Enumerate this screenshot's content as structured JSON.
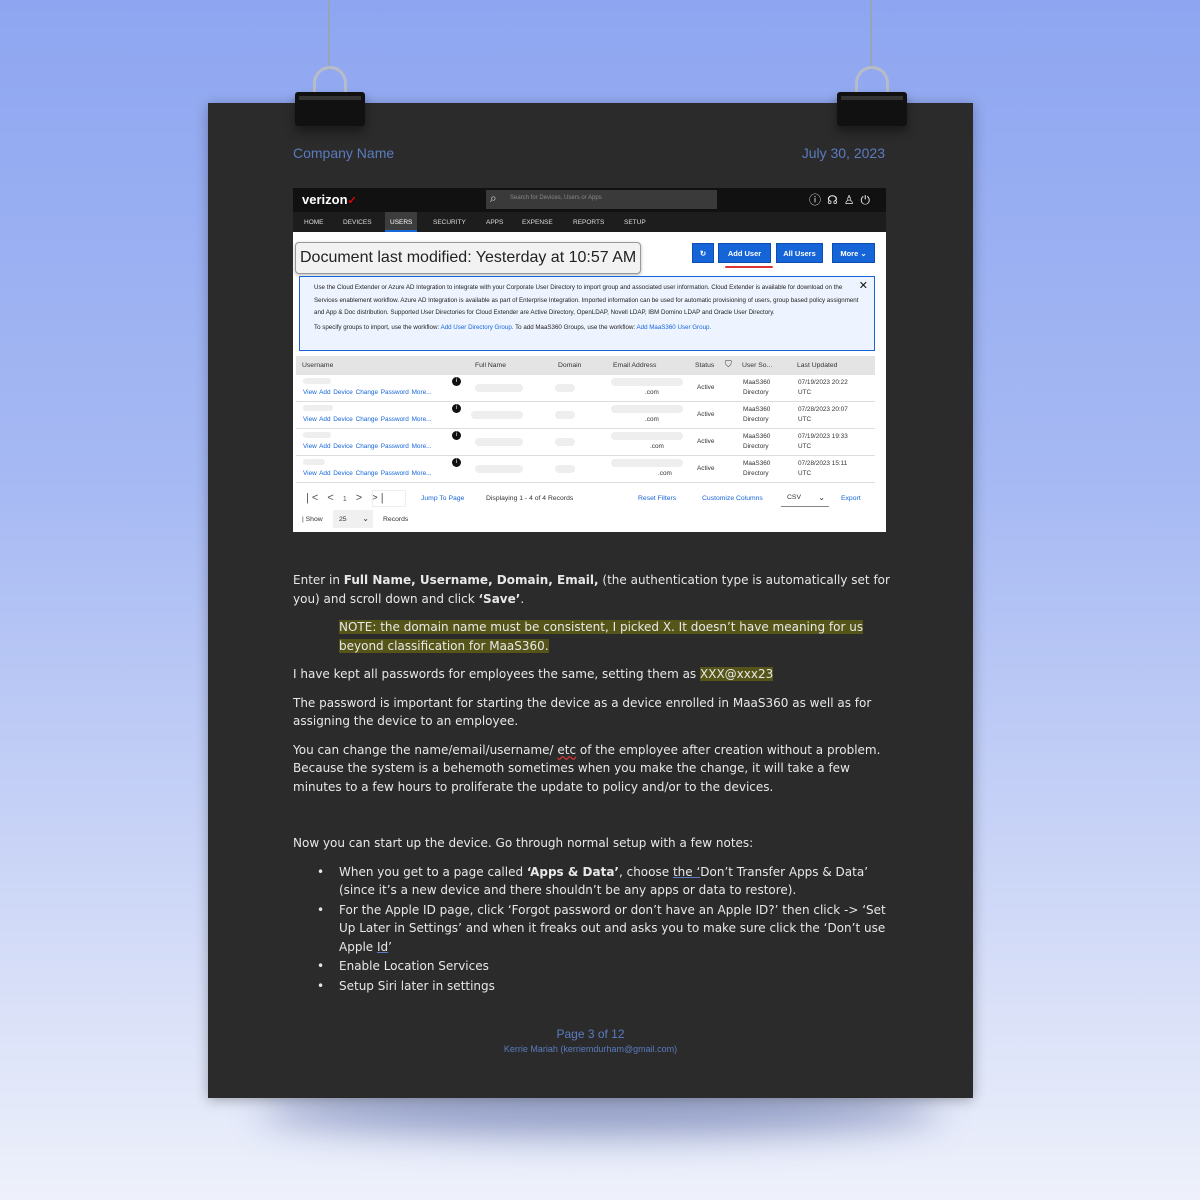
{
  "header": {
    "company": "Company Name",
    "date": "July 30, 2023"
  },
  "screenshot": {
    "brand": "verizon",
    "search_placeholder": "Search for Devices, Users or Apps",
    "nav": [
      "HOME",
      "DEVICES",
      "USERS",
      "SECURITY",
      "APPS",
      "EXPENSE",
      "REPORTS",
      "SETUP"
    ],
    "active_nav": "USERS",
    "doc_modified": "Document last modified: Yesterday at 10:57 AM",
    "buttons": {
      "refresh": "↻",
      "add_user": "Add User",
      "all_users": "All Users",
      "more": "More"
    },
    "info": {
      "line1": "Use the Cloud Extender or Azure AD Integration to integrate with your Corporate User Directory to import group and associated user information. Cloud Extender is available for download on the Services enablement workflow. Azure AD Integration is available as part of Enterprise Integration. Imported information can be used for automatic provisioning of users, group based policy assignment and App & Doc distribution. Supported User Directories for Cloud Extender are Active Directory, OpenLDAP, Novell LDAP, IBM Domino LDAP and Oracle User Directory.",
      "line2_pre": "To specify groups to import, use the workflow:",
      "link1": "Add User Directory Group.",
      "line2_mid": "To add MaaS360 Groups, use the workflow:",
      "link2": "Add MaaS360 User Group."
    },
    "columns": [
      "Username",
      "Full Name",
      "Domain",
      "Email Address",
      "Status",
      "User So...",
      "Last Updated"
    ],
    "row_links": "View  Add Device   Change Password   More...",
    "rows": [
      {
        "email_tail": ".com",
        "status": "Active",
        "source1": "MaaS360",
        "source2": "Directory",
        "updated1": "07/19/2023 20:22",
        "updated2": "UTC"
      },
      {
        "email_tail": ".com",
        "status": "Active",
        "source1": "MaaS360",
        "source2": "Directory",
        "updated1": "07/28/2023 20:07",
        "updated2": "UTC"
      },
      {
        "email_tail": ".com",
        "status": "Active",
        "source1": "MaaS360",
        "source2": "Directory",
        "updated1": "07/19/2023 19:33",
        "updated2": "UTC"
      },
      {
        "email_tail": ".com",
        "status": "Active",
        "source1": "MaaS360",
        "source2": "Directory",
        "updated1": "07/28/2023 15:11",
        "updated2": "UTC"
      }
    ],
    "pager": {
      "page": "1",
      "jump": "Jump To Page",
      "displaying": "Displaying 1 - 4 of 4 Records",
      "reset": "Reset Filters",
      "customize": "Customize Columns",
      "format": "CSV",
      "export": "Export",
      "show": "| Show",
      "per_page": "25",
      "records": "Records"
    }
  },
  "body": {
    "p1_a": "Enter in ",
    "p1_b": "Full Name, Username, Domain, Email,",
    "p1_c": " (the authentication type is automatically set for you) and scroll down and click ",
    "p1_d": "‘Save’",
    "p1_e": ".",
    "note": "NOTE: the domain name must be consistent, I picked X. It doesn’t have meaning for us beyond classification for MaaS360.",
    "p2_a": "I have kept all passwords for employees the same, setting them as ",
    "p2_pw": "XXX@xxx23",
    "p3": "The password is important for starting the device as a device enrolled in MaaS360 as well as for assigning the device to an employee.",
    "p4_a": "You can change the name/email/username/ ",
    "p4_etc": "etc",
    "p4_b": " of the employee after creation without a problem. Because the system is a behemoth sometimes when you make the change, it will take a few minutes to a few hours to proliferate the update to policy and/or to the devices.",
    "p5": "Now you can start up the device. Go through normal setup with a few notes:",
    "b1_a": "When you get to a page called ",
    "b1_b": "‘Apps & Data’",
    "b1_c": ", choose ",
    "b1_the": "the ‘",
    "b1_d": "Don’t Transfer Apps & Data’ (since it’s a new device and there shouldn’t be any apps or data to restore).",
    "b2_a": "For the Apple ID page, click ‘Forgot password or don’t have an Apple ID?’ then click -> ‘Set Up Later in Settings’ and when it freaks out and asks you to make sure click the ‘Don’t use Apple ",
    "b2_id": "Id",
    "b2_b": "’",
    "b3": "Enable Location Services",
    "b4": "Setup Siri later in settings"
  },
  "footer": {
    "page": "Page 3 of 12",
    "author": "Kerrie Mariah (kerriemdurham@gmail.com)"
  }
}
